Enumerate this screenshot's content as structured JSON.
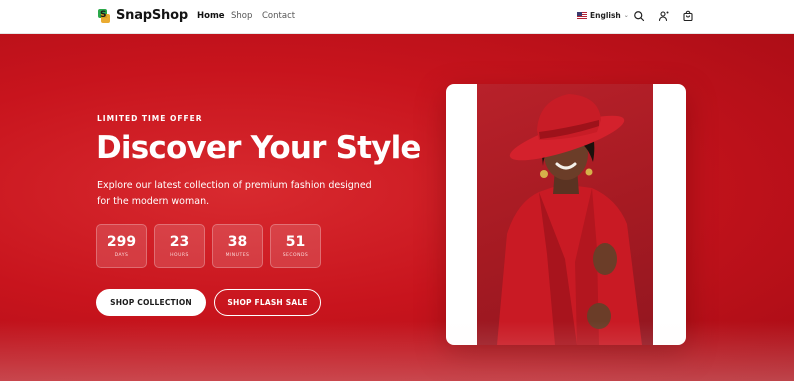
{
  "brand": {
    "name": "SnapShop",
    "logo_letter": "S"
  },
  "nav": {
    "links": [
      {
        "label": "Home",
        "active": true
      },
      {
        "label": "Shop",
        "active": false
      },
      {
        "label": "Contact",
        "active": false
      }
    ],
    "language": {
      "label": "English",
      "flag": "us-flag"
    },
    "icons": [
      "search-icon",
      "account-icon",
      "cart-icon"
    ]
  },
  "hero": {
    "eyebrow": "LIMITED TIME OFFER",
    "title": "Discover Your Style",
    "description": "Explore our latest collection of premium fashion designed for the modern woman.",
    "countdown": [
      {
        "value": "299",
        "label": "DAYS"
      },
      {
        "value": "23",
        "label": "HOURS"
      },
      {
        "value": "38",
        "label": "MINUTES"
      },
      {
        "value": "51",
        "label": "SECONDS"
      }
    ],
    "primary_button": "SHOP COLLECTION",
    "secondary_button": "SHOP FLASH SALE",
    "image_icon": "model-in-red-hat-photo"
  },
  "colors": {
    "accent": "#c8141d",
    "background_dark": "#a80c15",
    "button_text": "#1a1a1a",
    "nav_bg": "#ffffff"
  }
}
